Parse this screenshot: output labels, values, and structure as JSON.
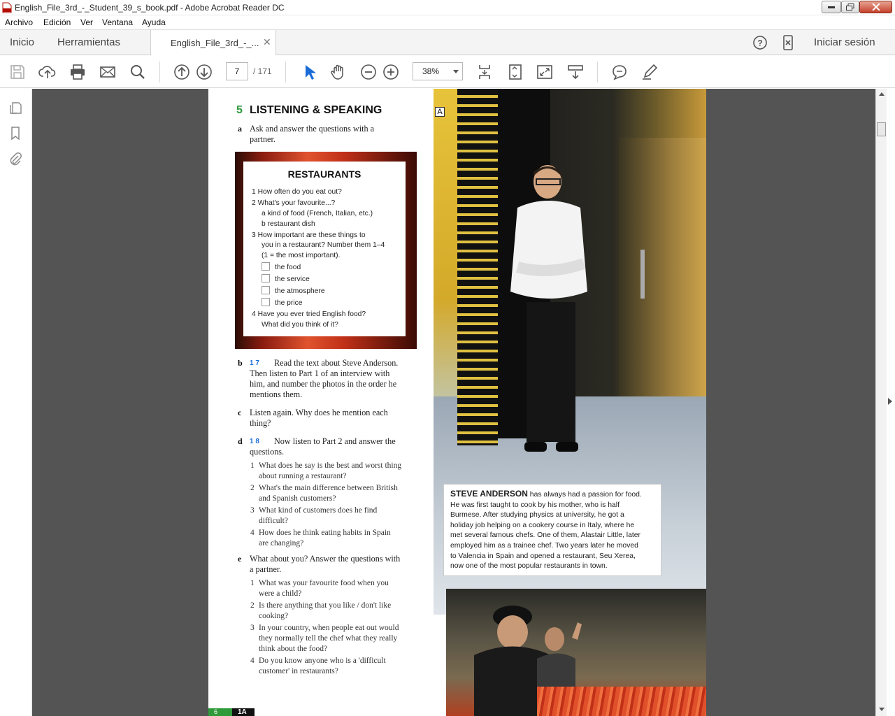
{
  "window": {
    "title": "English_File_3rd_-_Student_39_s_book.pdf - Adobe Acrobat Reader DC"
  },
  "menu": [
    "Archivo",
    "Edición",
    "Ver",
    "Ventana",
    "Ayuda"
  ],
  "tabs": {
    "home": "Inicio",
    "tools": "Herramientas",
    "document": "English_File_3rd_-_...",
    "signin": "Iniciar sesión"
  },
  "toolbar": {
    "page_current": "7",
    "page_total": "/ 171",
    "zoom": "38%"
  },
  "page": {
    "section_number": "5",
    "section_title": "LISTENING & SPEAKING",
    "a": {
      "letter": "a",
      "text": "Ask and answer the questions with a partner."
    },
    "restaurants": {
      "title": "RESTAURANTS",
      "lines": [
        "1  How often do you eat out?",
        "2  What's your favourite...?",
        "a  kind of food (French, Italian, etc.)",
        "b  restaurant dish",
        "3  How important are these things to",
        "you in a restaurant? Number them 1–4",
        "(1 = the most important).",
        "the food",
        "the service",
        "the atmosphere",
        "the price",
        "4  Have you ever tried English food?",
        "What did you think of it?"
      ]
    },
    "b": {
      "letter": "b",
      "audio": "1 7",
      "lines": [
        "Read the text about Steve Anderson.",
        "Then listen to Part 1 of an interview with",
        "him, and number the photos in the order he",
        "mentions them."
      ]
    },
    "c": {
      "letter": "c",
      "lines": [
        "Listen again. Why does he mention each",
        "thing?"
      ]
    },
    "d": {
      "letter": "d",
      "audio": "1 8",
      "lines": [
        "Now listen to Part 2 and answer the",
        "questions."
      ],
      "items": [
        {
          "n": "1",
          "lines": [
            "What does he say is the best and worst thing",
            "about running a restaurant?"
          ]
        },
        {
          "n": "2",
          "lines": [
            "What's the main difference between British",
            "and Spanish customers?"
          ]
        },
        {
          "n": "3",
          "lines": [
            "What kind of customers does he find",
            "difficult?"
          ]
        },
        {
          "n": "4",
          "lines": [
            "How does he think eating habits in Spain",
            "are changing?"
          ]
        }
      ]
    },
    "e": {
      "letter": "e",
      "lines": [
        "What about you? Answer the questions with",
        "a partner."
      ],
      "items": [
        {
          "n": "1",
          "lines": [
            "What was your favourite food when you",
            "were a child?"
          ]
        },
        {
          "n": "2",
          "lines": [
            "Is there anything that you like / don't like",
            "cooking?"
          ]
        },
        {
          "n": "3",
          "lines": [
            "In your country, when people eat out would",
            "they normally tell the chef what they really",
            "think about the food?"
          ]
        },
        {
          "n": "4",
          "lines": [
            "Do you know anyone who is a 'difficult",
            "customer' in restaurants?"
          ]
        }
      ]
    },
    "photo_label": "A",
    "caption": {
      "name": "STEVE ANDERSON",
      "lines": [
        " has always had a passion for food.",
        "He was first taught to cook by his mother, who is half",
        "Burmese. After studying physics at university, he got a",
        "holiday job helping on a cookery course in Italy, where he",
        "met several famous chefs. One of them, Alastair Little, later",
        "employed him as a trainee chef. Two years later he moved",
        "to Valencia in Spain and opened a restaurant, Seu Xerea,",
        "now one of the most popular restaurants in town."
      ]
    },
    "footer": {
      "page": "6",
      "unit": "1A"
    }
  }
}
